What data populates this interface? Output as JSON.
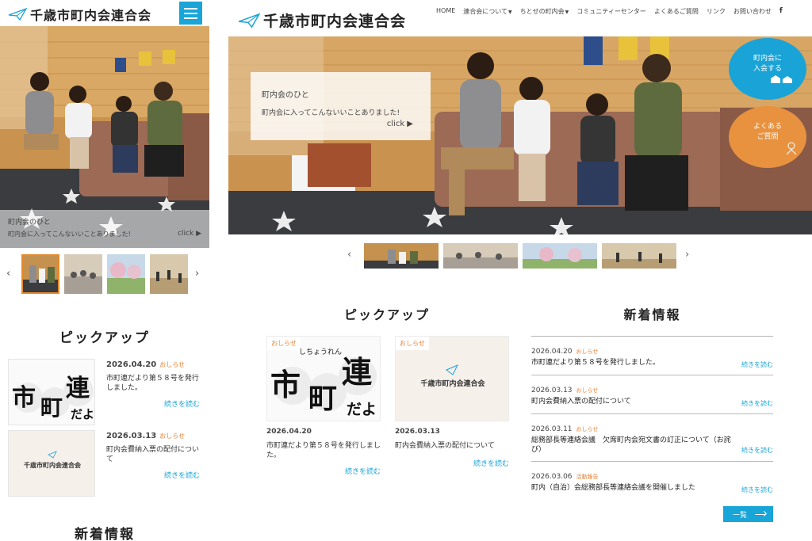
{
  "brand": {
    "name": "千歳市町内会連合会"
  },
  "nav": {
    "items": [
      "HOME",
      "連合会について",
      "ちとせの町内会",
      "コミュニティーセンター",
      "よくあるご質問",
      "リンク",
      "お問い合わせ"
    ],
    "facebook": "f"
  },
  "hero": {
    "caption_line1": "町内会のひと",
    "caption_line2": "町内会に入ってこんないいことありました!",
    "click_label": "click ▶"
  },
  "bubbles": {
    "join_line1": "町内会に",
    "join_line2": "入会する",
    "faq_line1": "よくある",
    "faq_line2": "ご質問"
  },
  "slider": {
    "prev": "‹",
    "next": "›"
  },
  "pickup": {
    "title": "ピックアップ",
    "items": [
      {
        "date": "2026.04.20",
        "category": "おしらせ",
        "title": "市町連だより第５８号を発行しました。",
        "more": "続きを読む",
        "image_text": "しちょうれん",
        "tag": "おしらせ"
      },
      {
        "date": "2026.03.13",
        "category": "おしらせ",
        "title": "町内会費納入票の配付について",
        "more": "続きを読む",
        "image_text": "千歳市町内会連合会",
        "tag": "おしらせ"
      }
    ]
  },
  "news": {
    "title": "新着情報",
    "items": [
      {
        "date": "2026.04.20",
        "category": "おしらせ",
        "title": "市町連だより第５８号を発行しました。",
        "more": "続きを読む"
      },
      {
        "date": "2026.03.13",
        "category": "おしらせ",
        "title": "町内会費納入票の配付について",
        "more": "続きを読む"
      },
      {
        "date": "2026.03.11",
        "category": "おしらせ",
        "title": "総務部長等連絡会議　欠席町内会宛文書の訂正について（お詫び）",
        "more": "続きを読む"
      },
      {
        "date": "2026.03.06",
        "category": "活動報告",
        "title": "町内（自治）会総務部長等連絡会議を開催しました",
        "more": "続きを読む"
      }
    ],
    "list_button": "一覧"
  },
  "colors": {
    "accent": "#19a5d8",
    "orange": "#e8843a",
    "bubble_orange": "#e8923f"
  }
}
